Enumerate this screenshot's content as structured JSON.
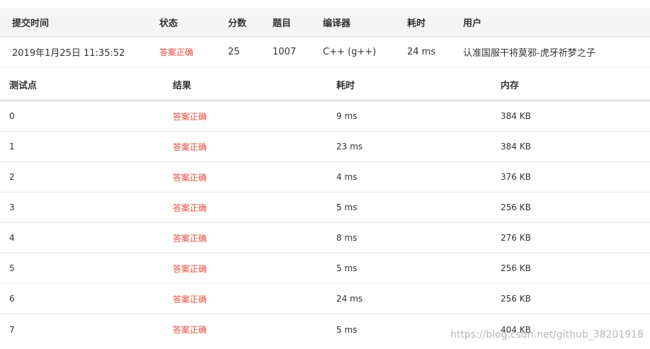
{
  "submission": {
    "headers": {
      "time": "提交时间",
      "status": "状态",
      "score": "分数",
      "problem": "题目",
      "compiler": "编译器",
      "cost": "耗时",
      "user": "用户"
    },
    "row": {
      "time": "2019年1月25日 11:35:52",
      "status": "答案正确",
      "score": "25",
      "problem": "1007",
      "compiler": "C++ (g++)",
      "cost": "24 ms",
      "user": "认准国服干将莫邪-虎牙祈梦之子"
    }
  },
  "cases": {
    "headers": {
      "id": "测试点",
      "result": "结果",
      "time": "耗时",
      "memory": "内存"
    },
    "rows": [
      {
        "id": "0",
        "result": "答案正确",
        "time": "9 ms",
        "memory": "384 KB"
      },
      {
        "id": "1",
        "result": "答案正确",
        "time": "23 ms",
        "memory": "384 KB"
      },
      {
        "id": "2",
        "result": "答案正确",
        "time": "4 ms",
        "memory": "376 KB"
      },
      {
        "id": "3",
        "result": "答案正确",
        "time": "5 ms",
        "memory": "256 KB"
      },
      {
        "id": "4",
        "result": "答案正确",
        "time": "8 ms",
        "memory": "276 KB"
      },
      {
        "id": "5",
        "result": "答案正确",
        "time": "5 ms",
        "memory": "256 KB"
      },
      {
        "id": "6",
        "result": "答案正确",
        "time": "24 ms",
        "memory": "256 KB"
      },
      {
        "id": "7",
        "result": "答案正确",
        "time": "5 ms",
        "memory": "404 KB"
      }
    ]
  },
  "watermark": "https://blog.csdn.net/github_38201918",
  "colors": {
    "accepted": "#e64c3c",
    "header_bg": "#f5f5f5"
  }
}
